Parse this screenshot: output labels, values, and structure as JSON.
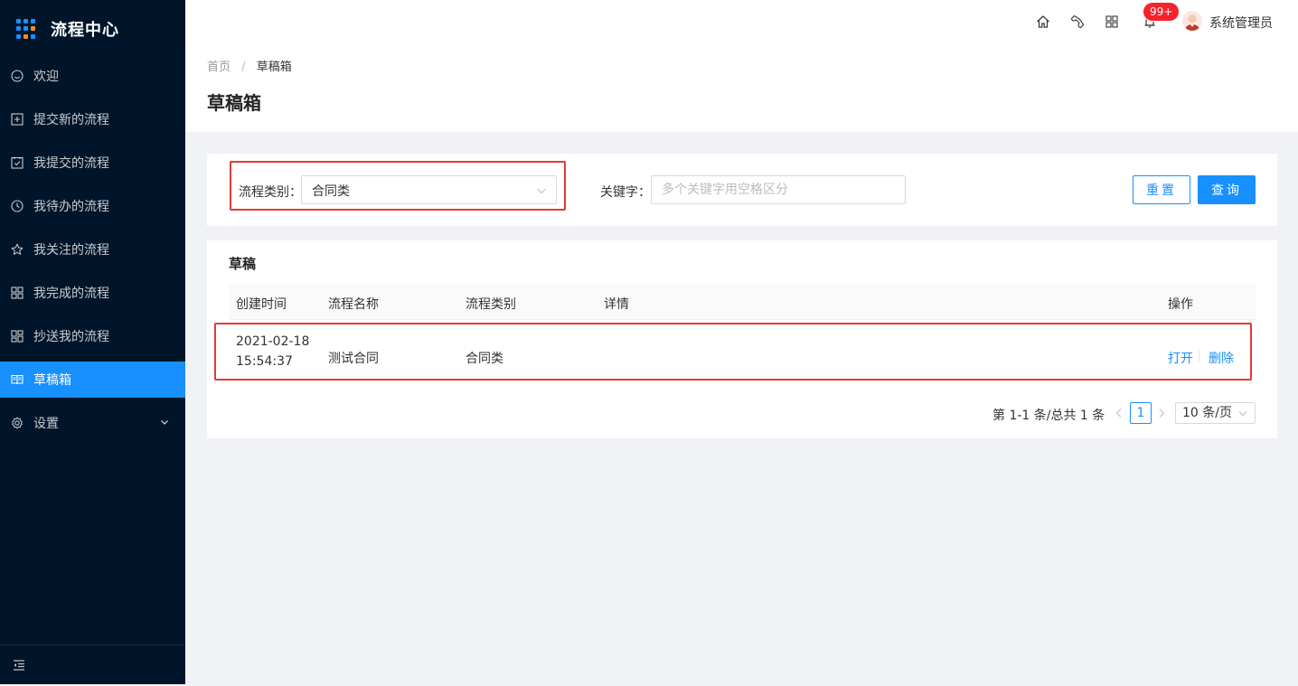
{
  "app": {
    "title": "流程中心"
  },
  "sidebar": {
    "items": [
      {
        "label": "欢迎",
        "icon": "smile-icon"
      },
      {
        "label": "提交新的流程",
        "icon": "plus-square-icon"
      },
      {
        "label": "我提交的流程",
        "icon": "check-square-icon"
      },
      {
        "label": "我待办的流程",
        "icon": "clock-icon"
      },
      {
        "label": "我关注的流程",
        "icon": "star-icon"
      },
      {
        "label": "我完成的流程",
        "icon": "appstore-icon"
      },
      {
        "label": "抄送我的流程",
        "icon": "copy-icon"
      },
      {
        "label": "草稿箱",
        "icon": "book-icon",
        "active": true
      },
      {
        "label": "设置",
        "icon": "setting-icon"
      }
    ]
  },
  "header": {
    "notification_count": "99+",
    "username": "系统管理员"
  },
  "breadcrumb": {
    "home": "首页",
    "separator": "/",
    "current": "草稿箱"
  },
  "page": {
    "title": "草稿箱"
  },
  "filter": {
    "category_label": "流程类别：",
    "category_value": "合同类",
    "keyword_label": "关键字：",
    "keyword_placeholder": "多个关键字用空格区分",
    "reset_label": "重置",
    "search_label": "查询"
  },
  "table": {
    "title": "草稿",
    "columns": [
      "创建时间",
      "流程名称",
      "流程类别",
      "详情",
      "操作"
    ],
    "rows": [
      {
        "created_date": "2021-02-18",
        "created_time": "15:54:37",
        "name": "测试合同",
        "category": "合同类",
        "detail": "",
        "actions": [
          "打开",
          "删除"
        ]
      }
    ]
  },
  "pagination": {
    "total_text": "第 1-1 条/总共 1 条",
    "current_page": "1",
    "page_size": "10 条/页"
  },
  "colors": {
    "sidebar_bg": "#001529",
    "primary": "#1890ff",
    "highlight_border": "#e53935",
    "badge": "#f5222d"
  }
}
